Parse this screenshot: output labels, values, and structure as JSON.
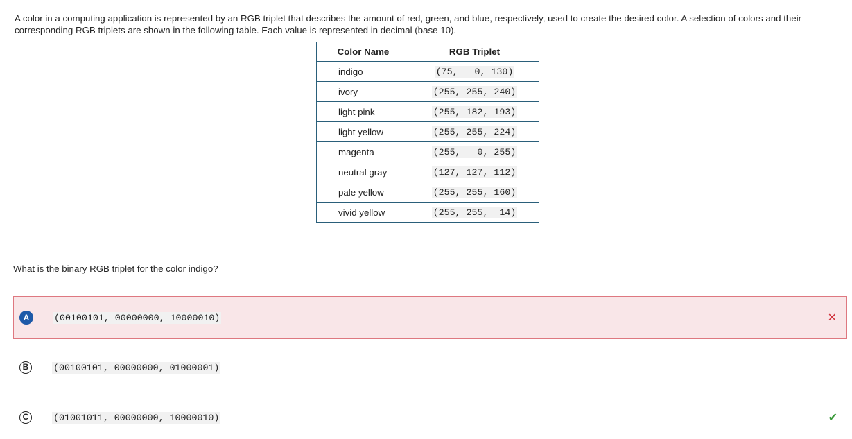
{
  "intro": "A color in a computing application is represented by an RGB triplet that describes the amount of red, green, and blue, respectively, used to create the desired color. A selection of colors and their corresponding RGB triplets are shown in the following table. Each value is represented in decimal (base 10).",
  "table": {
    "headers": [
      "Color Name",
      "RGB Triplet"
    ],
    "rows": [
      {
        "name": "indigo",
        "rgb": "(75,   0, 130)"
      },
      {
        "name": "ivory",
        "rgb": "(255, 255, 240)"
      },
      {
        "name": "light pink",
        "rgb": "(255, 182, 193)"
      },
      {
        "name": "light yellow",
        "rgb": "(255, 255, 224)"
      },
      {
        "name": "magenta",
        "rgb": "(255,   0, 255)"
      },
      {
        "name": "neutral gray",
        "rgb": "(127, 127, 112)"
      },
      {
        "name": "pale yellow",
        "rgb": "(255, 255, 160)"
      },
      {
        "name": "vivid yellow",
        "rgb": "(255, 255,  14)"
      }
    ]
  },
  "question": "What is the binary RGB triplet for the color indigo?",
  "choices": [
    {
      "letter": "A",
      "text": "(00100101, 00000000, 10000010)",
      "mark": "✕"
    },
    {
      "letter": "B",
      "text": "(00100101, 00000000, 01000001)",
      "mark": ""
    },
    {
      "letter": "C",
      "text": "(01001011, 00000000, 10000010)",
      "mark": "✔"
    }
  ],
  "colors": {
    "wrong_bg": "#f9e6e8",
    "wrong_border": "#de7880",
    "wrong_mark": "#d0323c",
    "correct_mark": "#3a9a3a",
    "selected_letter_bg": "#1e5aa8",
    "table_border": "#2a5f7a"
  },
  "icons": {
    "wrong": "close-icon",
    "correct": "checkmark-icon"
  }
}
